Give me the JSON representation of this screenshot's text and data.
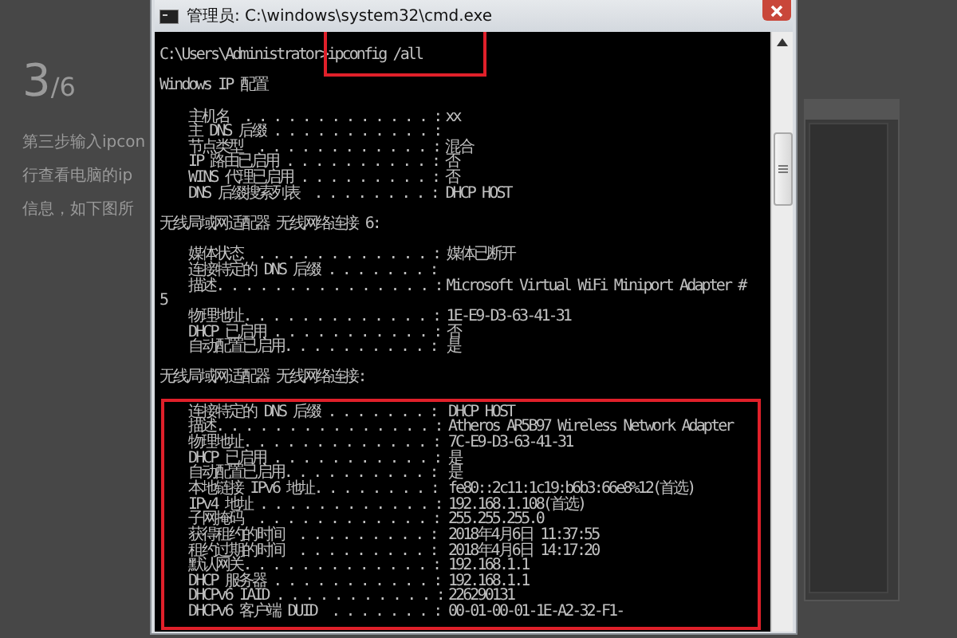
{
  "background_page": {
    "step_number": "3",
    "step_total": "/6",
    "instruction_lines": [
      "第三步输入ipcon",
      "行查看电脑的ip",
      "信息，如下图所"
    ]
  },
  "window": {
    "title": "管理员: C:\\windows\\system32\\cmd.exe"
  },
  "console": {
    "prompt": "C:\\Users\\Administrator>",
    "command": "ipconfig /all",
    "command_highlighted": true,
    "sections": [
      {
        "heading": "Windows IP 配置",
        "highlighted": false,
        "fields": [
          {
            "label": "主机名  . . . . . . . . . . . . . :",
            "value": "xx"
          },
          {
            "label": "主 DNS 后缀 . . . . . . . . . . . :"
          },
          {
            "label": "节点类型  . . . . . . . . . . . . :",
            "value": "混合"
          },
          {
            "label": "IP 路由已启用 . . . . . . . . . . :",
            "value": "否"
          },
          {
            "label": "WINS 代理已启用 . . . . . . . . . :",
            "value": "否"
          },
          {
            "label": "DNS 后缀搜索列表  . . . . . . . . :",
            "value": "DHCP HOST"
          }
        ]
      },
      {
        "heading": "无线局域网适配器 无线网络连接 6:",
        "highlighted": false,
        "fields": [
          {
            "label": "媒体状态  . . . . . . . . . . . . :",
            "value": "媒体已断开"
          },
          {
            "label": "连接特定的 DNS 后缀 . . . . . . . :"
          },
          {
            "label": "描述. . . . . . . . . . . . . . . :",
            "value": "Microsoft Virtual WiFi Miniport Adapter #",
            "continuation": "5"
          },
          {
            "label": "物理地址. . . . . . . . . . . . . :",
            "value": "1E-E9-D3-63-41-31"
          },
          {
            "label": "DHCP 已启用 . . . . . . . . . . . :",
            "value": "否"
          },
          {
            "label": "自动配置已启用. . . . . . . . . . :",
            "value": "是"
          }
        ]
      },
      {
        "heading": "无线局域网适配器 无线网络连接:",
        "highlighted": true,
        "fields": [
          {
            "label": "连接特定的 DNS 后缀 . . . . . . . :",
            "value": "DHCP HOST"
          },
          {
            "label": "描述. . . . . . . . . . . . . . . :",
            "value": "Atheros AR5B97 Wireless Network Adapter"
          },
          {
            "label": "物理地址. . . . . . . . . . . . . :",
            "value": "7C-E9-D3-63-41-31"
          },
          {
            "label": "DHCP 已启用 . . . . . . . . . . . :",
            "value": "是"
          },
          {
            "label": "自动配置已启用. . . . . . . . . . :",
            "value": "是"
          },
          {
            "label": "本地链接 IPv6 地址. . . . . . . . :",
            "value": "fe80::2c11:1c19:b6b3:66e8%12(首选)"
          },
          {
            "label": "IPv4 地址 . . . . . . . . . . . . :",
            "value": "192.168.1.108(首选)"
          },
          {
            "label": "子网掩码  . . . . . . . . . . . . :",
            "value": "255.255.255.0"
          },
          {
            "label": "获得租约的时间  . . . . . . . . . :",
            "value": "2018年4月6日 11:37:55"
          },
          {
            "label": "租约过期的时间  . . . . . . . . . :",
            "value": "2018年4月6日 14:17:20"
          },
          {
            "label": "默认网关. . . . . . . . . . . . . :",
            "value": "192.168.1.1"
          },
          {
            "label": "DHCP 服务器 . . . . . . . . . . . :",
            "value": "192.168.1.1"
          },
          {
            "label": "DHCPv6 IAID . . . . . . . . . . . :",
            "value": "226290131"
          },
          {
            "label": "DHCPv6 客户端 DUID  . . . . . . . :",
            "value": "00-01-00-01-1E-A2-32-F1-"
          }
        ]
      }
    ]
  }
}
